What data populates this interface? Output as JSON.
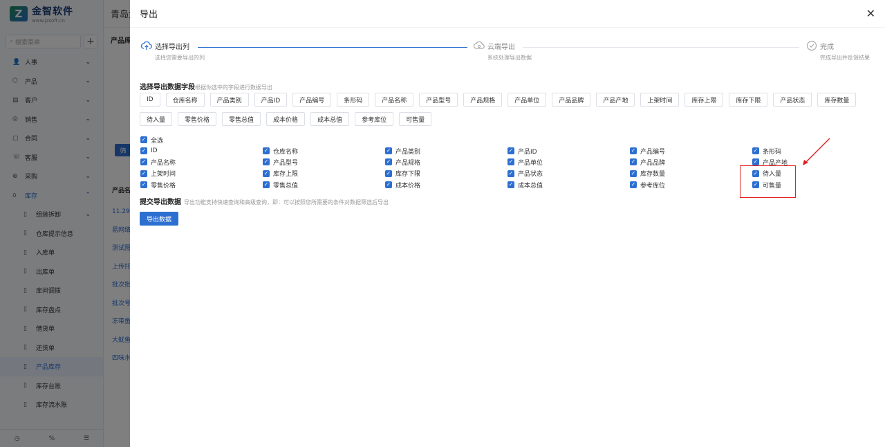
{
  "logo": {
    "name": "金智软件",
    "url": "www.jzsoft.cn"
  },
  "sidebar": {
    "search_placeholder": "搜索菜单",
    "items": [
      {
        "label": "人事",
        "icon": "person-icon"
      },
      {
        "label": "产品",
        "icon": "box-icon"
      },
      {
        "label": "客户",
        "icon": "customer-icon"
      },
      {
        "label": "销售",
        "icon": "sales-icon"
      },
      {
        "label": "合同",
        "icon": "contract-icon"
      },
      {
        "label": "客服",
        "icon": "service-icon"
      },
      {
        "label": "采购",
        "icon": "purchase-icon"
      },
      {
        "label": "库存",
        "icon": "inventory-icon"
      }
    ],
    "sub_items": [
      {
        "label": "组装拆卸"
      },
      {
        "label": "仓库提示信息"
      },
      {
        "label": "入库单"
      },
      {
        "label": "出库单"
      },
      {
        "label": "库间调拨"
      },
      {
        "label": "库存盘点"
      },
      {
        "label": "借货单"
      },
      {
        "label": "还货单"
      },
      {
        "label": "产品库存"
      },
      {
        "label": "库存台账"
      },
      {
        "label": "库存流水账"
      }
    ]
  },
  "background": {
    "topbar_title": "青岛金",
    "tab": "产品库",
    "filter_button": "筛",
    "table_header": "产品名",
    "rows": [
      "11.29新",
      "易网络",
      "测试图",
      "上传托",
      "批次批",
      "批次号",
      "冻带鱼",
      "大鱿鱼",
      "四味水"
    ]
  },
  "drawer": {
    "title": "导出",
    "steps": [
      {
        "title": "选择导出列",
        "desc": "选择您需要导出的列"
      },
      {
        "title": "云端导出",
        "desc": "系统处理导出数据"
      },
      {
        "title": "完成",
        "desc": "完成导出并反馈结果"
      }
    ],
    "section_title": "选择导出数据字段",
    "section_hint": "根据你选中的字段进行数据导出",
    "tags": [
      "ID",
      "仓库名称",
      "产品类别",
      "产品ID",
      "产品编号",
      "条形码",
      "产品名称",
      "产品型号",
      "产品规格",
      "产品单位",
      "产品品牌",
      "产品产地",
      "上架时间",
      "库存上限",
      "库存下限",
      "产品状态",
      "库存数量",
      "待入量",
      "零售价格",
      "零售总值",
      "成本价格",
      "成本总值",
      "参考库位",
      "可售量"
    ],
    "select_all": "全选",
    "checkboxes": [
      "ID",
      "仓库名称",
      "产品类别",
      "产品ID",
      "产品编号",
      "条形码",
      "产品名称",
      "产品型号",
      "产品规格",
      "产品单位",
      "产品品牌",
      "产品产地",
      "上架时间",
      "库存上限",
      "库存下限",
      "产品状态",
      "库存数量",
      "待入量",
      "零售价格",
      "零售总值",
      "成本价格",
      "成本总值",
      "参考库位",
      "可售量"
    ],
    "submit_title": "提交导出数据",
    "submit_hint": "导出功能支持快速查询和高级查询，即：可以按照您所需要的条件对数据筛选后导出",
    "export_button": "导出数据"
  },
  "colors": {
    "primary": "#2d6fd1",
    "annotation": "#e02020"
  }
}
